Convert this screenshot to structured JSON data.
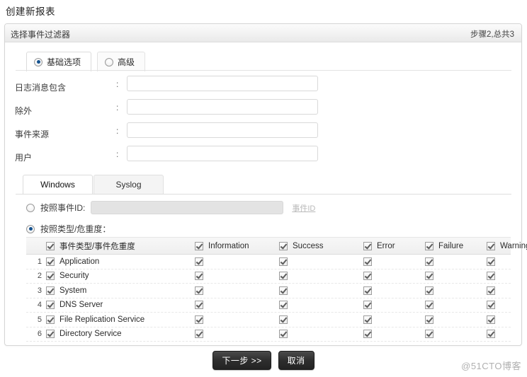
{
  "page": {
    "title": "创建新报表"
  },
  "panel": {
    "header_title": "选择事件过滤器",
    "step_text": "步骤2,总共3"
  },
  "mode_tabs": [
    {
      "label": "基础选项",
      "selected": true
    },
    {
      "label": "高级",
      "selected": false
    }
  ],
  "fields": [
    {
      "label": "日志消息包含",
      "separator": ":",
      "value": "",
      "placeholder": ""
    },
    {
      "label": "除外",
      "separator": ":",
      "value": "",
      "placeholder": ""
    },
    {
      "label": "事件来源",
      "separator": ":",
      "value": "",
      "placeholder": ""
    },
    {
      "label": "用户",
      "separator": ":",
      "value": "",
      "placeholder": ""
    }
  ],
  "log_tabs": [
    {
      "label": "Windows",
      "active": true
    },
    {
      "label": "Syslog",
      "active": false
    }
  ],
  "filter_mode": {
    "by_event_id": {
      "label": "按照事件ID:",
      "selected": false,
      "value": "",
      "placeholder": "",
      "link_label": "事件ID"
    },
    "by_type_severity": {
      "label": "按照类型/危重度：",
      "selected": true
    }
  },
  "grid": {
    "columns": [
      {
        "label": "事件类型/事件危重度",
        "checked": true
      },
      {
        "label": "Information",
        "checked": true
      },
      {
        "label": "Success",
        "checked": true
      },
      {
        "label": "Error",
        "checked": true
      },
      {
        "label": "Failure",
        "checked": true
      },
      {
        "label": "Warning",
        "checked": true
      }
    ],
    "rows": [
      {
        "index": "1",
        "name": "Application",
        "checked": true,
        "cells": [
          true,
          true,
          true,
          true,
          true
        ]
      },
      {
        "index": "2",
        "name": "Security",
        "checked": true,
        "cells": [
          true,
          true,
          true,
          true,
          true
        ]
      },
      {
        "index": "3",
        "name": "System",
        "checked": true,
        "cells": [
          true,
          true,
          true,
          true,
          true
        ]
      },
      {
        "index": "4",
        "name": "DNS Server",
        "checked": true,
        "cells": [
          true,
          true,
          true,
          true,
          true
        ]
      },
      {
        "index": "5",
        "name": "File Replication Service",
        "checked": true,
        "cells": [
          true,
          true,
          true,
          true,
          true
        ]
      },
      {
        "index": "6",
        "name": "Directory Service",
        "checked": true,
        "cells": [
          true,
          true,
          true,
          true,
          true
        ]
      }
    ]
  },
  "footer": {
    "next_label": "下一步 >>",
    "cancel_label": "取消"
  },
  "watermark": {
    "text": "@51CTO博客"
  },
  "colors": {
    "accent": "#14528f",
    "button_bg": "#2e2e2e",
    "panel_border": "#d5d5d5"
  }
}
